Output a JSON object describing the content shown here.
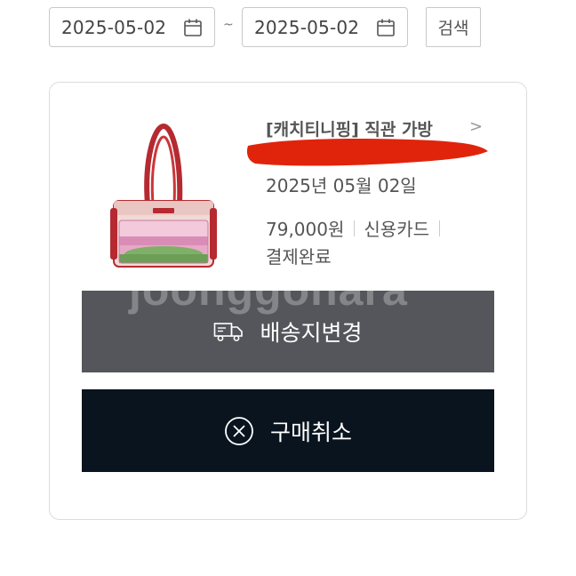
{
  "filter": {
    "start_date": "2025-05-02",
    "end_date": "2025-05-02",
    "separator": "~",
    "search_label": "검색"
  },
  "order": {
    "product_title": "[캐치티니핑] 직관 가방",
    "chevron": ">",
    "order_date": "2025년 05월 02일",
    "price": "79,000원",
    "payment_method": "신용카드",
    "status": "결제완료"
  },
  "watermark": "joonggonara",
  "actions": {
    "change_address_label": "배송지변경",
    "cancel_purchase_label": "구매취소"
  },
  "colors": {
    "ship_button_bg": "#55565b",
    "cancel_button_bg": "#0a141e",
    "redaction": "#e0240c"
  },
  "icons": {
    "date": "calendar-icon",
    "ship": "delivery-truck-icon",
    "cancel": "circle-x-icon"
  }
}
